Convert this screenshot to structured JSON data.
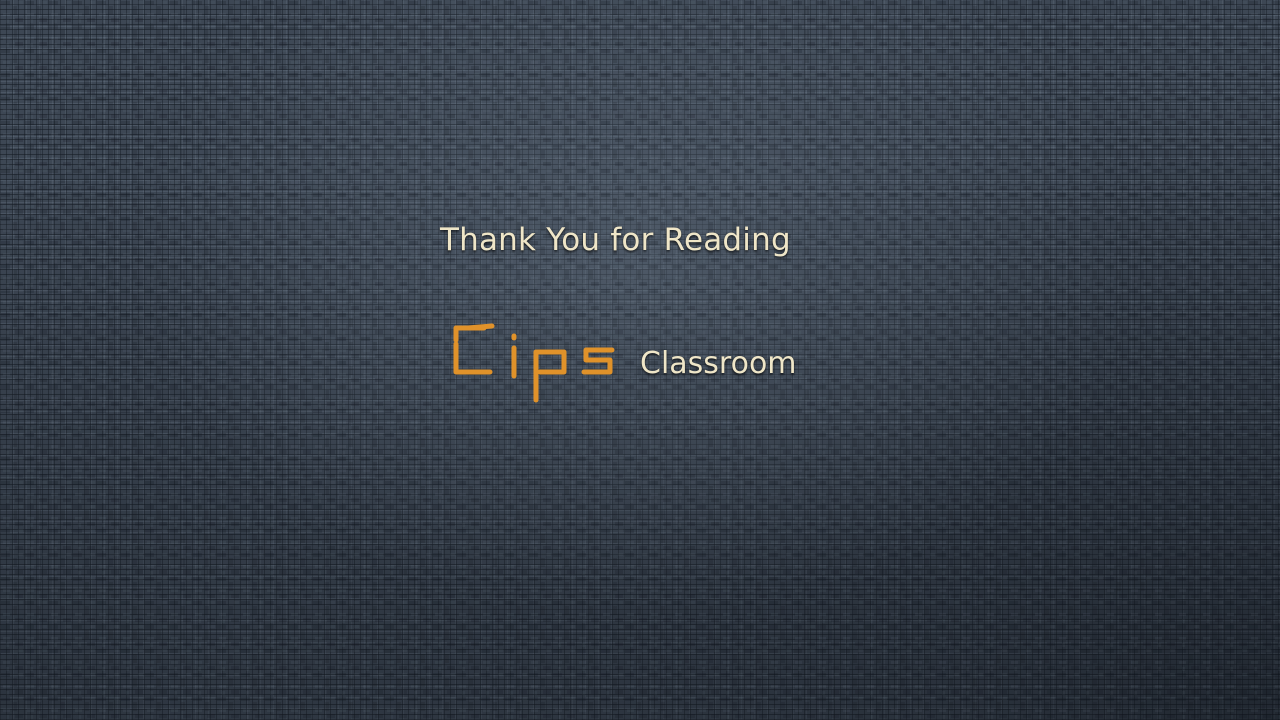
{
  "slide": {
    "heading": "Thank You for Reading",
    "logo": {
      "mark_text": "Cips",
      "word": "Classroom"
    }
  },
  "colors": {
    "background": "#3d4754",
    "text": "#efe6c8",
    "logo_accent": "#e0922a"
  }
}
